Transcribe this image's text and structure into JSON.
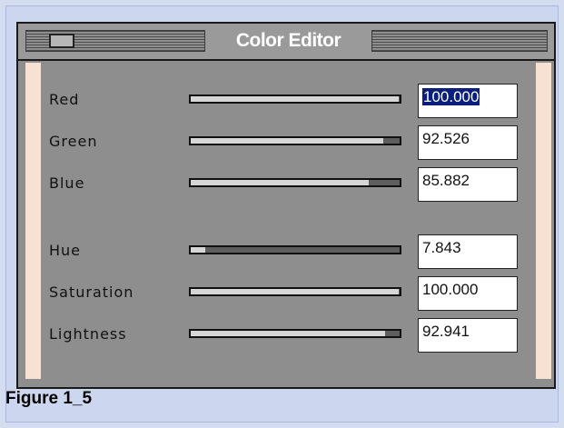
{
  "window": {
    "title": "Color Editor",
    "sidebar_color": "#f6e1d3",
    "selection_color": "#0a1e7e"
  },
  "rows": [
    {
      "label": "Red",
      "value": "100.000",
      "level": 0.995,
      "selected": true
    },
    {
      "label": "Green",
      "value": "92.526",
      "level": 0.92
    },
    {
      "label": "Blue",
      "value": "85.882",
      "level": 0.85
    },
    {
      "label": "Hue",
      "value": "7.843",
      "level": 0.07
    },
    {
      "label": "Saturation",
      "value": "100.000",
      "level": 0.995
    },
    {
      "label": "Lightness",
      "value": "92.941",
      "level": 0.93
    }
  ],
  "caption": "Figure 1_5"
}
